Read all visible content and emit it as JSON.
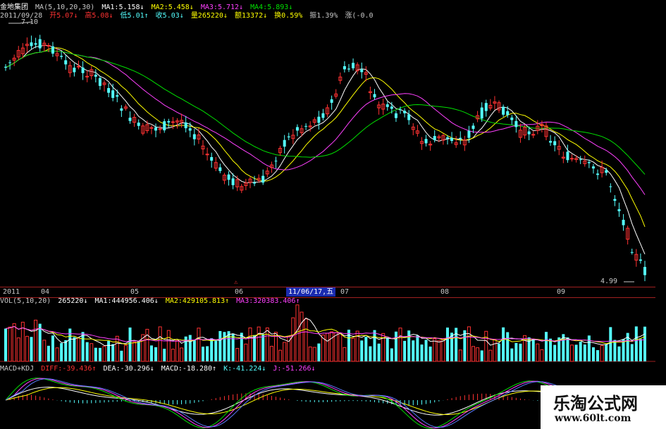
{
  "header": {
    "stock_name": "金地集团",
    "ma_label": "MA(5,10,20,30)",
    "ma1": "MA1:5.158↓",
    "ma2": "MA2:5.458↓",
    "ma3": "MA3:5.712↓",
    "ma4": "MA4:5.893↓",
    "date": "2011/09/28",
    "open": "开5.07↓",
    "high": "高5.08↓",
    "low": "低5.01↑",
    "close": "收5.03↓",
    "volume": "量265220↓",
    "amount": "额13372↓",
    "turnover": "换0.59%",
    "amplitude": "振1.39%",
    "change": "涨(-0.0"
  },
  "price_panel": {
    "high_mark": "7.10",
    "low_mark": "4.99"
  },
  "axis": {
    "year": "2011",
    "months": [
      "04",
      "05",
      "06",
      "07",
      "08",
      "09"
    ],
    "selected_date": "11/06/17,五",
    "marker": "⚠"
  },
  "vol_header": {
    "label": "VOL(5,10,20)",
    "value": "265220↓",
    "ma1": "MA1:444956.406↓",
    "ma2": "MA2:429105.813↑",
    "ma3": "MA3:320383.406↑"
  },
  "macd_header": {
    "label": "MACD+KDJ",
    "diff": "DIFF:-39.436↑",
    "dea": "DEA:-30.296↓",
    "macd": "MACD:-18.280↑",
    "k": "K:-41.224↓",
    "j": "J:-51.266↓"
  },
  "watermark": {
    "title": "乐淘公式网",
    "url": "www.60lt.com"
  },
  "colors": {
    "up": "#ff3232",
    "down": "#54ffff",
    "ma1": "#ffffff",
    "ma2": "#ffff00",
    "ma3": "#ff40ff",
    "ma4": "#00e000",
    "axis": "#a02020"
  }
}
